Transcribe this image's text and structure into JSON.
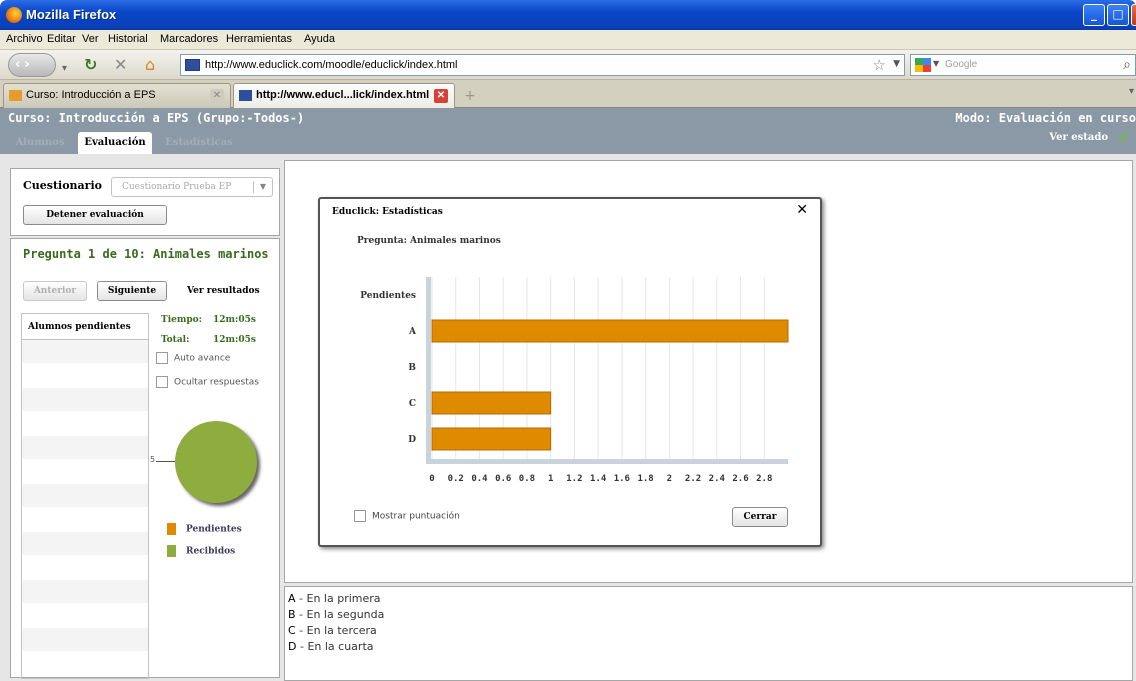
{
  "window": {
    "title": "Mozilla Firefox",
    "controls": [
      "_",
      "□",
      "X"
    ]
  },
  "menu": [
    "Archivo",
    "Editar",
    "Ver",
    "Historial",
    "Marcadores",
    "Herramientas",
    "Ayuda"
  ],
  "nav": {
    "url": "http://www.educlick.com/moodle/educlick/index.html",
    "search_placeholder": "Google"
  },
  "tabs": [
    {
      "label": "Curso: Introducción a EPS"
    },
    {
      "label": "http://www.educl...lick/index.html"
    }
  ],
  "app": {
    "course": "Curso: Introducción a EPS  (Grupo:-Todos-)",
    "mode": "Modo: Evaluación en curso",
    "status_link": "Ver estado",
    "tabs": [
      "Alumnos",
      "Evaluación",
      "Estadísticas"
    ],
    "quiz_label": "Cuestionario",
    "quiz_select": "Cuestionario Prueba EP",
    "stop_button": "Detener evaluación",
    "question_title": "Pregunta 1 de 10: Animales marinos",
    "prev_button": "Anterior",
    "next_button": "Siguiente",
    "results_link": "Ver resultados",
    "pending_header": "Alumnos pendientes",
    "time_label": "Tiempo:",
    "time_value": "12m:05s",
    "total_label": "Total:",
    "total_value": "12m:05s",
    "auto_advance": "Auto avance",
    "hide_answers": "Ocultar respuestas",
    "pie_label": "5",
    "legend": [
      {
        "label": "Pendientes",
        "color": "#e08a00"
      },
      {
        "label": "Recibidos",
        "color": "#8fac3f"
      }
    ],
    "answers": [
      {
        "letter": "A",
        "text": " - En la primera"
      },
      {
        "letter": "B",
        "text": " - En la segunda"
      },
      {
        "letter": "C",
        "text": " - En la tercera"
      },
      {
        "letter": "D",
        "text": " - En la cuarta"
      }
    ]
  },
  "dialog": {
    "title": "Educlick: Estadísticas",
    "question": "Pregunta: Animales marinos",
    "show_score": "Mostrar puntuación",
    "close_button": "Cerrar"
  },
  "chart_data": {
    "type": "bar",
    "orientation": "horizontal",
    "categories": [
      "Pendientes",
      "A",
      "B",
      "C",
      "D"
    ],
    "values": [
      0,
      3,
      0,
      1,
      1
    ],
    "xticks": [
      "0",
      "0.2",
      "0.4",
      "0.6",
      "0.8",
      "1",
      "1.2",
      "1.4",
      "1.6",
      "1.8",
      "2",
      "2.2",
      "2.4",
      "2.6",
      "2.8"
    ],
    "xlim": [
      0,
      3
    ],
    "bar_color": "#e08a00",
    "grid": true
  }
}
